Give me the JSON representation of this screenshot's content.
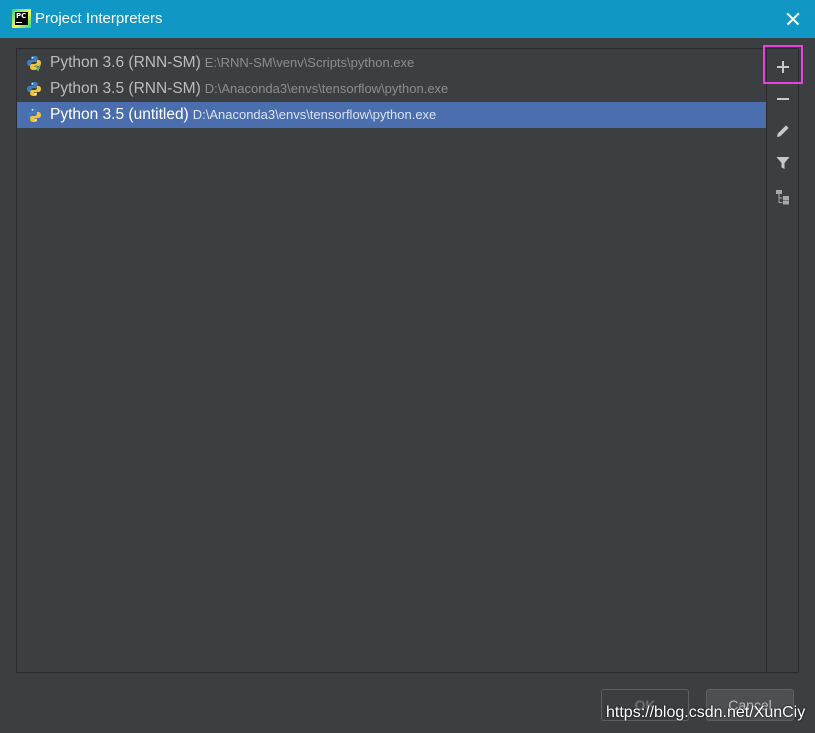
{
  "window": {
    "title": "Project Interpreters",
    "app_icon": "pycharm-icon",
    "close_icon": "close-icon"
  },
  "interpreters": [
    {
      "name": "Python 3.6 (RNN-SM)",
      "path": "E:\\RNN-SM\\venv\\Scripts\\python.exe",
      "icon": "python-venv-icon",
      "selected": false
    },
    {
      "name": "Python 3.5 (RNN-SM)",
      "path": "D:\\Anaconda3\\envs\\tensorflow\\python.exe",
      "icon": "python-icon",
      "selected": false
    },
    {
      "name": "Python 3.5 (untitled)",
      "path": "D:\\Anaconda3\\envs\\tensorflow\\python.exe",
      "icon": "python-icon",
      "selected": true
    }
  ],
  "toolbar": {
    "icons": [
      "plus-icon",
      "minus-icon",
      "edit-icon",
      "filter-icon",
      "tree-icon"
    ]
  },
  "buttons": {
    "ok_label": "OK",
    "cancel_label": "Cancel"
  },
  "watermark": "https://blog.csdn.net/XunCiy",
  "colors": {
    "titlebar": "#1197c6",
    "background": "#3c3f41",
    "selection": "#4b6eaf",
    "highlight_box": "#e83fe0"
  }
}
